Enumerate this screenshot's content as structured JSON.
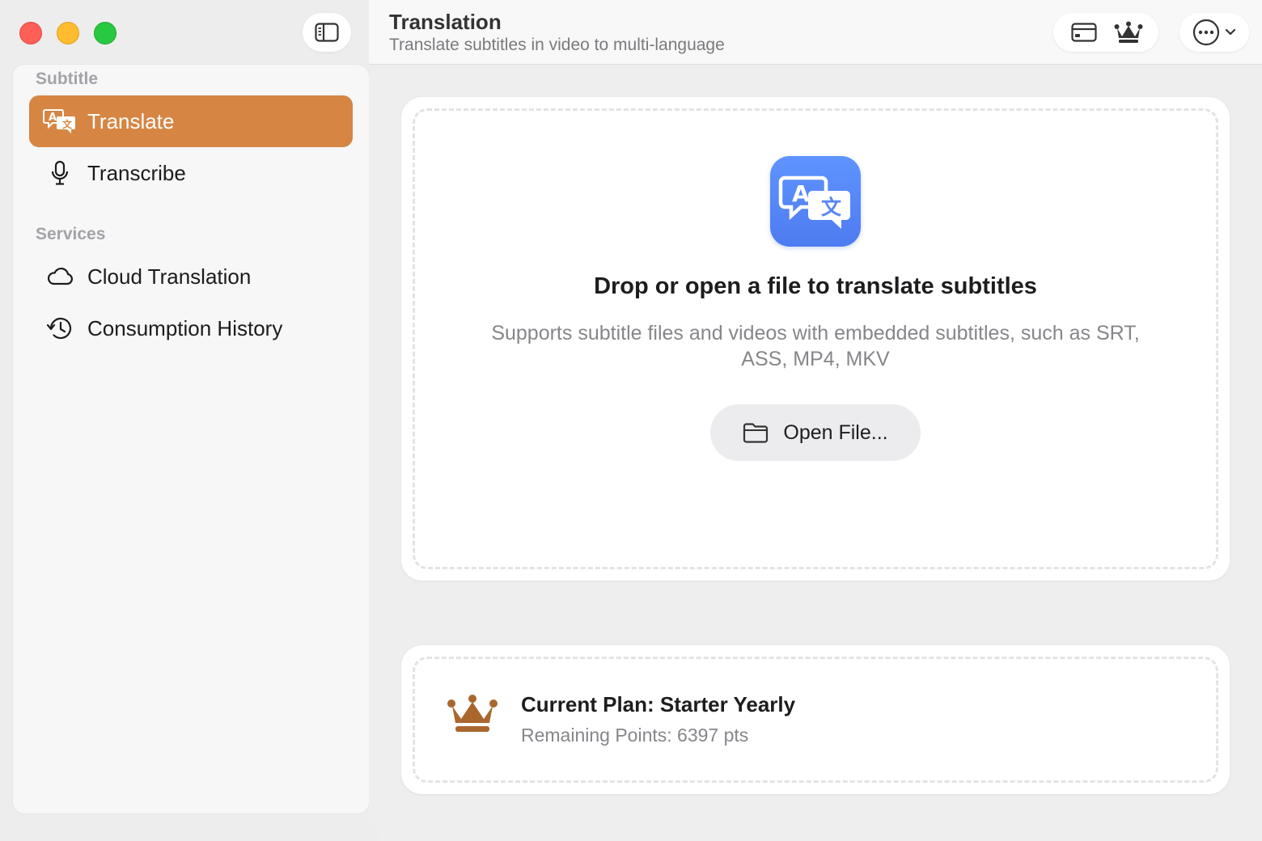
{
  "header": {
    "title": "Translation",
    "subtitle": "Translate subtitles in video to multi-language"
  },
  "sidebar": {
    "sections": [
      {
        "label": "Subtitle",
        "items": [
          {
            "label": "Translate",
            "icon": "translate-icon",
            "active": true
          },
          {
            "label": "Transcribe",
            "icon": "microphone-icon",
            "active": false
          }
        ]
      },
      {
        "label": "Services",
        "items": [
          {
            "label": "Cloud Translation",
            "icon": "cloud-icon",
            "active": false
          },
          {
            "label": "Consumption History",
            "icon": "history-icon",
            "active": false
          }
        ]
      }
    ]
  },
  "dropzone": {
    "title": "Drop or open a file to translate subtitles",
    "description": "Supports subtitle files and videos with embedded subtitles, such as SRT, ASS, MP4, MKV",
    "open_button_label": "Open File..."
  },
  "plan": {
    "title": "Current Plan: Starter Yearly",
    "points": "Remaining Points: 6397 pts"
  },
  "colors": {
    "accent": "#d68543",
    "crown": "#a9672e",
    "app_icon": "#5b8cff"
  }
}
